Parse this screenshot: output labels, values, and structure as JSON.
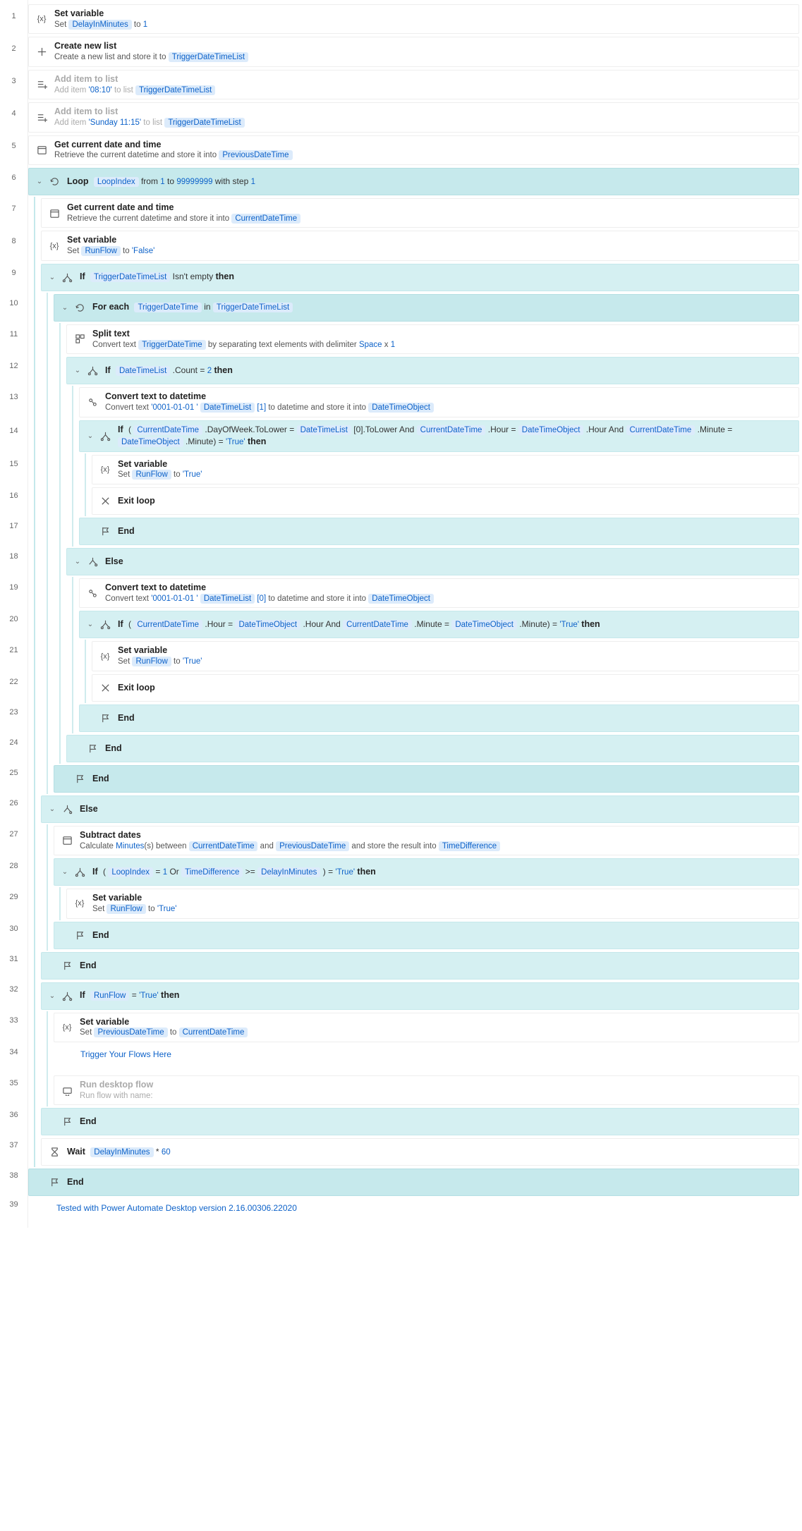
{
  "footer": "Tested with Power Automate Desktop version 2.16.00306.22020",
  "steps": [
    {
      "n": 1,
      "indent": 0,
      "type": "card",
      "icon": "var",
      "title": "Set variable",
      "desc": [
        "Set ",
        {
          "p": "DelayInMinutes"
        },
        " to ",
        {
          "l": "1"
        }
      ]
    },
    {
      "n": 2,
      "indent": 0,
      "type": "card",
      "icon": "plus",
      "title": "Create new list",
      "desc": [
        "Create a new list and store it to ",
        {
          "p": "TriggerDateTimeList"
        }
      ]
    },
    {
      "n": 3,
      "indent": 0,
      "type": "card",
      "icon": "addlist",
      "disabled": true,
      "title": "Add item to list",
      "desc": [
        "Add item ",
        {
          "l": "'08:10'"
        },
        " to list ",
        {
          "p": "TriggerDateTimeList"
        }
      ]
    },
    {
      "n": 4,
      "indent": 0,
      "type": "card",
      "icon": "addlist",
      "disabled": true,
      "title": "Add item to list",
      "desc": [
        "Add item ",
        {
          "l": "'Sunday 11:15'"
        },
        " to list ",
        {
          "p": "TriggerDateTimeList"
        }
      ]
    },
    {
      "n": 5,
      "indent": 0,
      "type": "card",
      "icon": "cal",
      "title": "Get current date and time",
      "desc": [
        "Retrieve the current datetime and store it into ",
        {
          "p": "PreviousDateTime"
        }
      ]
    },
    {
      "n": 6,
      "indent": 0,
      "type": "block",
      "hl": "hl2",
      "chev": true,
      "icon": "loop",
      "rich": [
        {
          "b": "Loop"
        },
        "  ",
        {
          "p": "LoopIndex"
        },
        "   from ",
        {
          "l": "1"
        },
        " to ",
        {
          "l": "99999999"
        },
        " with step ",
        {
          "l": "1"
        }
      ]
    },
    {
      "n": 7,
      "indent": 1,
      "type": "card",
      "icon": "cal",
      "title": "Get current date and time",
      "desc": [
        "Retrieve the current datetime and store it into ",
        {
          "p": "CurrentDateTime"
        }
      ]
    },
    {
      "n": 8,
      "indent": 1,
      "type": "card",
      "icon": "var",
      "title": "Set variable",
      "desc": [
        "Set ",
        {
          "p": "RunFlow"
        },
        " to ",
        {
          "l": "'False'"
        }
      ]
    },
    {
      "n": 9,
      "indent": 1,
      "type": "block",
      "hl": "hl",
      "chev": true,
      "icon": "if",
      "rich": [
        {
          "b": "If"
        },
        "  ",
        {
          "p": "TriggerDateTimeList"
        },
        "  Isn't empty  ",
        {
          "b": "then"
        }
      ]
    },
    {
      "n": 10,
      "indent": 2,
      "type": "block",
      "hl": "hl2",
      "chev": true,
      "icon": "loop",
      "rich": [
        {
          "b": "For each"
        },
        "   ",
        {
          "p": "TriggerDateTime"
        },
        "  in  ",
        {
          "p": "TriggerDateTimeList"
        }
      ]
    },
    {
      "n": 11,
      "indent": 3,
      "type": "card",
      "icon": "split",
      "title": "Split text",
      "desc": [
        "Convert text ",
        {
          "p": "TriggerDateTime"
        },
        " by separating text elements with delimiter ",
        {
          "l": "Space"
        },
        " x ",
        {
          "l": "1"
        }
      ]
    },
    {
      "n": 12,
      "indent": 3,
      "type": "block",
      "hl": "hl",
      "chev": true,
      "icon": "if",
      "rich": [
        {
          "b": "If"
        },
        "  ",
        {
          "p": "DateTimeList"
        },
        " .Count = ",
        {
          "l": "2"
        },
        " ",
        {
          "b": "then"
        }
      ]
    },
    {
      "n": 13,
      "indent": 4,
      "type": "card",
      "icon": "conv",
      "title": "Convert text to datetime",
      "desc": [
        "Convert text ",
        {
          "l": "'0001-01-01 '"
        },
        " ",
        {
          "p": "DateTimeList"
        },
        " ",
        {
          "l": "[1]"
        },
        " to datetime and store it into ",
        {
          "p": "DateTimeObject"
        }
      ]
    },
    {
      "n": 14,
      "indent": 4,
      "type": "block",
      "hl": "hl",
      "chev": true,
      "icon": "if",
      "rich": [
        {
          "b": "If"
        },
        " ( ",
        {
          "p": "CurrentDateTime"
        },
        " .DayOfWeek.ToLower = ",
        {
          "p": "DateTimeList"
        },
        " [0].ToLower And ",
        {
          "p": "CurrentDateTime"
        },
        " .Hour = ",
        {
          "p": "DateTimeObject"
        },
        " .Hour And ",
        {
          "p": "CurrentDateTime"
        },
        " .Minute = ",
        {
          "p": "DateTimeObject"
        },
        " .Minute) = ",
        {
          "l": "'True'"
        },
        " ",
        {
          "b": "then"
        }
      ]
    },
    {
      "n": 15,
      "indent": 5,
      "type": "card",
      "icon": "var",
      "title": "Set variable",
      "desc": [
        "Set ",
        {
          "p": "RunFlow"
        },
        " to ",
        {
          "l": "'True'"
        }
      ]
    },
    {
      "n": 16,
      "indent": 5,
      "type": "card",
      "icon": "x",
      "title": "Exit loop"
    },
    {
      "n": 17,
      "indent": 4,
      "type": "block",
      "hl": "hl",
      "icon": "flag",
      "rich": [
        {
          "b": "End"
        }
      ]
    },
    {
      "n": 18,
      "indent": 3,
      "type": "block",
      "hl": "hl",
      "chev": true,
      "icon": "else",
      "rich": [
        {
          "b": "Else"
        }
      ]
    },
    {
      "n": 19,
      "indent": 4,
      "type": "card",
      "icon": "conv",
      "title": "Convert text to datetime",
      "desc": [
        "Convert text ",
        {
          "l": "'0001-01-01 '"
        },
        " ",
        {
          "p": "DateTimeList"
        },
        " ",
        {
          "l": "[0]"
        },
        " to datetime and store it into ",
        {
          "p": "DateTimeObject"
        }
      ]
    },
    {
      "n": 20,
      "indent": 4,
      "type": "block",
      "hl": "hl",
      "chev": true,
      "icon": "if",
      "rich": [
        {
          "b": "If"
        },
        " ( ",
        {
          "p": "CurrentDateTime"
        },
        " .Hour = ",
        {
          "p": "DateTimeObject"
        },
        " .Hour And ",
        {
          "p": "CurrentDateTime"
        },
        " .Minute = ",
        {
          "p": "DateTimeObject"
        },
        " .Minute) = ",
        {
          "l": "'True'"
        },
        " ",
        {
          "b": "then"
        }
      ]
    },
    {
      "n": 21,
      "indent": 5,
      "type": "card",
      "icon": "var",
      "title": "Set variable",
      "desc": [
        "Set ",
        {
          "p": "RunFlow"
        },
        " to ",
        {
          "l": "'True'"
        }
      ]
    },
    {
      "n": 22,
      "indent": 5,
      "type": "card",
      "icon": "x",
      "title": "Exit loop"
    },
    {
      "n": 23,
      "indent": 4,
      "type": "block",
      "hl": "hl",
      "icon": "flag",
      "rich": [
        {
          "b": "End"
        }
      ]
    },
    {
      "n": 24,
      "indent": 3,
      "type": "block",
      "hl": "hl",
      "icon": "flag",
      "rich": [
        {
          "b": "End"
        }
      ]
    },
    {
      "n": 25,
      "indent": 2,
      "type": "block",
      "hl": "hl2",
      "icon": "flag",
      "rich": [
        {
          "b": "End"
        }
      ]
    },
    {
      "n": 26,
      "indent": 1,
      "type": "block",
      "hl": "hl",
      "chev": true,
      "icon": "else",
      "rich": [
        {
          "b": "Else"
        }
      ]
    },
    {
      "n": 27,
      "indent": 2,
      "type": "card",
      "icon": "cal",
      "title": "Subtract dates",
      "desc": [
        "Calculate ",
        {
          "l": "Minutes"
        },
        "(s) between ",
        {
          "p": "CurrentDateTime"
        },
        " and ",
        {
          "p": "PreviousDateTime"
        },
        " and store the result into ",
        {
          "p": "TimeDifference"
        }
      ]
    },
    {
      "n": 28,
      "indent": 2,
      "type": "block",
      "hl": "hl",
      "chev": true,
      "icon": "if",
      "rich": [
        {
          "b": "If"
        },
        " ( ",
        {
          "p": "LoopIndex"
        },
        "  = ",
        {
          "l": "1"
        },
        " Or ",
        {
          "p": "TimeDifference"
        },
        "  >= ",
        {
          "p": "DelayInMinutes"
        },
        " ) = ",
        {
          "l": "'True'"
        },
        " ",
        {
          "b": "then"
        }
      ]
    },
    {
      "n": 29,
      "indent": 3,
      "type": "card",
      "icon": "var",
      "title": "Set variable",
      "desc": [
        "Set ",
        {
          "p": "RunFlow"
        },
        " to ",
        {
          "l": "'True'"
        }
      ]
    },
    {
      "n": 30,
      "indent": 2,
      "type": "block",
      "hl": "hl",
      "icon": "flag",
      "rich": [
        {
          "b": "End"
        }
      ]
    },
    {
      "n": 31,
      "indent": 1,
      "type": "block",
      "hl": "hl",
      "icon": "flag",
      "rich": [
        {
          "b": "End"
        }
      ]
    },
    {
      "n": 32,
      "indent": 1,
      "type": "block",
      "hl": "hl",
      "chev": true,
      "icon": "if",
      "rich": [
        {
          "b": "If"
        },
        "  ",
        {
          "p": "RunFlow"
        },
        "  = ",
        {
          "l": "'True'"
        },
        " ",
        {
          "b": "then"
        }
      ]
    },
    {
      "n": 33,
      "indent": 2,
      "type": "card",
      "icon": "var",
      "title": "Set variable",
      "desc": [
        "Set ",
        {
          "p": "PreviousDateTime"
        },
        " to ",
        {
          "p": "CurrentDateTime"
        }
      ]
    },
    {
      "n": 34,
      "indent": 2,
      "type": "note",
      "text": "Trigger Your Flows Here"
    },
    {
      "n": 35,
      "indent": 2,
      "type": "card",
      "icon": "flow",
      "disabled": true,
      "title": "Run desktop flow",
      "desc": [
        "Run flow with name:"
      ]
    },
    {
      "n": 36,
      "indent": 1,
      "type": "block",
      "hl": "hl",
      "icon": "flag",
      "rich": [
        {
          "b": "End"
        }
      ]
    },
    {
      "n": 37,
      "indent": 1,
      "type": "card",
      "icon": "wait",
      "title": "Wait",
      "inline": true,
      "desc": [
        {
          "p": "DelayInMinutes"
        },
        " * ",
        {
          "l": "60"
        }
      ]
    },
    {
      "n": 38,
      "indent": 0,
      "type": "block",
      "hl": "hl2",
      "icon": "flag",
      "rich": [
        {
          "b": "End"
        }
      ]
    },
    {
      "n": 39,
      "indent": 0,
      "type": "footer"
    }
  ]
}
